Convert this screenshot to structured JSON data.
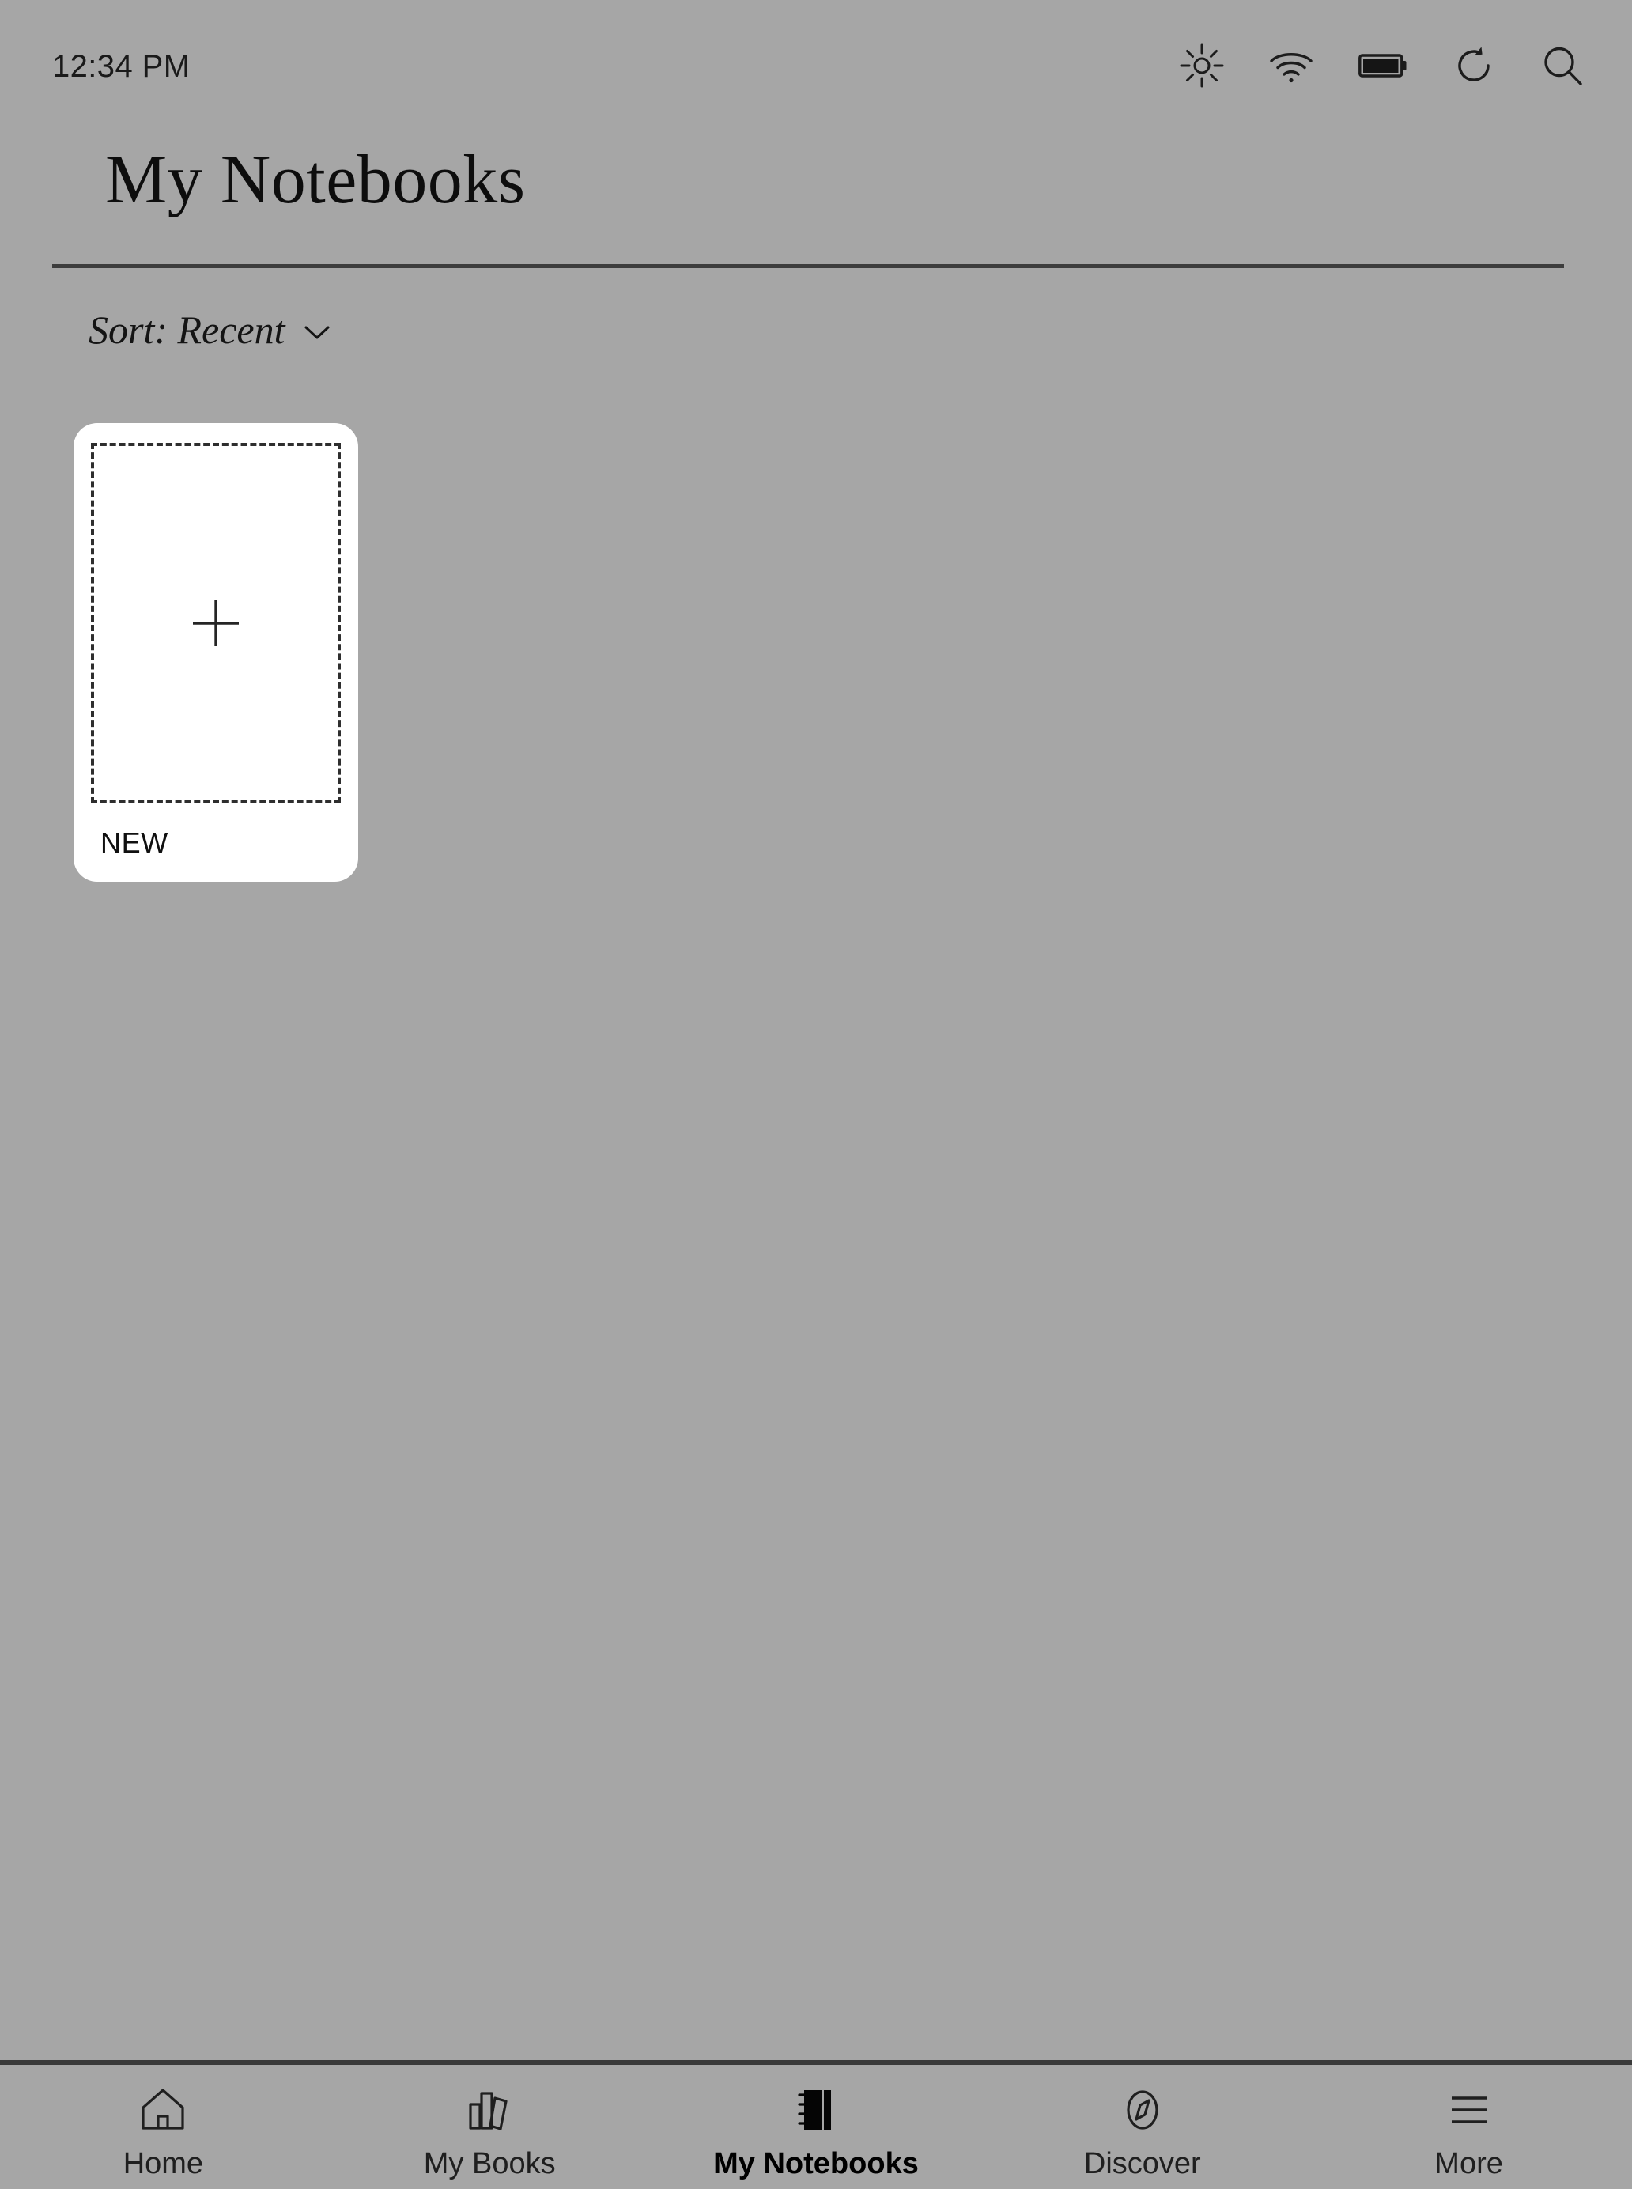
{
  "status_bar": {
    "time": "12:34 PM",
    "icons": [
      {
        "name": "brightness-icon",
        "label": "Brightness"
      },
      {
        "name": "wifi-icon",
        "label": "Wi-Fi"
      },
      {
        "name": "battery-icon",
        "label": "Battery"
      },
      {
        "name": "sync-icon",
        "label": "Sync"
      },
      {
        "name": "search-icon",
        "label": "Search"
      }
    ]
  },
  "header": {
    "title": "My Notebooks"
  },
  "sort": {
    "label": "Sort: Recent",
    "chevron": "chevron-down-icon"
  },
  "notebooks": [
    {
      "label": "NEW",
      "icon": "plus-icon",
      "type": "new-notebook"
    }
  ],
  "bottom_nav": {
    "items": [
      {
        "label": "Home",
        "icon": "home-icon",
        "active": false
      },
      {
        "label": "My Books",
        "icon": "books-icon",
        "active": false
      },
      {
        "label": "My Notebooks",
        "icon": "notebook-icon",
        "active": true
      },
      {
        "label": "Discover",
        "icon": "compass-icon",
        "active": false
      },
      {
        "label": "More",
        "icon": "hamburger-icon",
        "active": false
      }
    ]
  },
  "colors": {
    "background": "#a6a6a6",
    "card": "#ffffff",
    "ink": "#111111",
    "rule": "#3d3d3d"
  }
}
